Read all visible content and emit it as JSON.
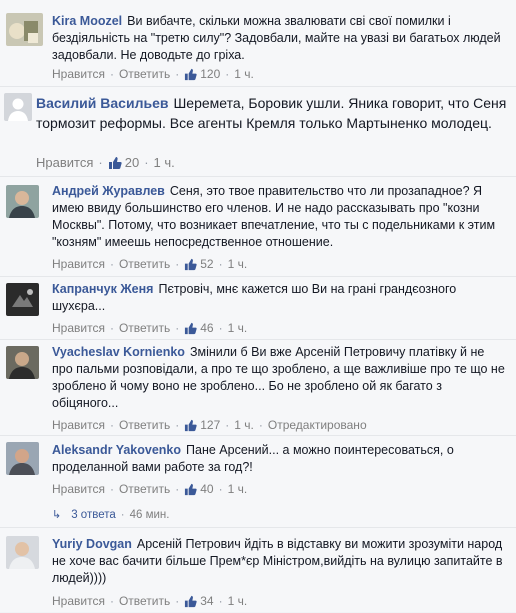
{
  "labels": {
    "like": "Нравится",
    "reply": "Ответить",
    "dot": "·"
  },
  "comments": [
    {
      "author": "Kira Moozel",
      "text": "Ви вибачте, скільки можна звалювати сві свої помилки і бездіяльність на \"третю силу\"? Задовбали, майте на увазі ви багатьох людей задовбали. Не доводьте до гріха.",
      "likes": "120",
      "time": "1 ч."
    },
    {
      "author": "Василий Васильев",
      "text": "Шеремета, Боровик ушли. Яника говорит, что Сеня тормозит реформы. Все агенты Кремля только Мартыненко молодец.",
      "likes": "20",
      "time": "1 ч."
    },
    {
      "author": "Андрей Журавлев",
      "text": "Сеня, это твое правительство что ли прозападное? Я имею ввиду большинство его членов. И не надо рассказывать про \"козни Москвы\". Потому, что возникает впечатление, что ты с подельниками к этим \"козням\" имеешь непосредственное отношение.",
      "likes": "52",
      "time": "1 ч."
    },
    {
      "author": "Капранчук Женя",
      "text": "Пєтровіч, мнє кажется шо Ви на грані грандєозного шухєра...",
      "likes": "46",
      "time": "1 ч."
    },
    {
      "author": "Vyacheslav Kornienko",
      "text": "Змінили б Ви вже Арсеній Петровичу платівку й не про пальми розповідали, а про те що зроблено, а ще важливіше про те що не зроблено й чому воно не зроблено... Бо не зроблено ой як багато з обіцяного...",
      "likes": "127",
      "time": "1 ч.",
      "edited": "Отредактировано"
    },
    {
      "author": "Aleksandr Yakovenko",
      "text": "Пане Арсений... а можно поинтересоваться, о проделанной вами работе за год?!",
      "likes": "40",
      "time": "1 ч."
    },
    {
      "author": "Yuriy Dovgan",
      "text": "Арсеній Петрович йдіть в відставку ви можити зрозуміти народ не хоче вас бачити більше Прем*єр Міністром,вийдіть на вулицю запитайте в людей))))",
      "likes": "34",
      "time": "1 ч."
    }
  ],
  "replies": {
    "count_label": "3 ответа",
    "time": "46 мин."
  },
  "colors": {
    "link": "#3b5998",
    "meta": "#7f7f7f",
    "background": "#f6f7f9"
  }
}
